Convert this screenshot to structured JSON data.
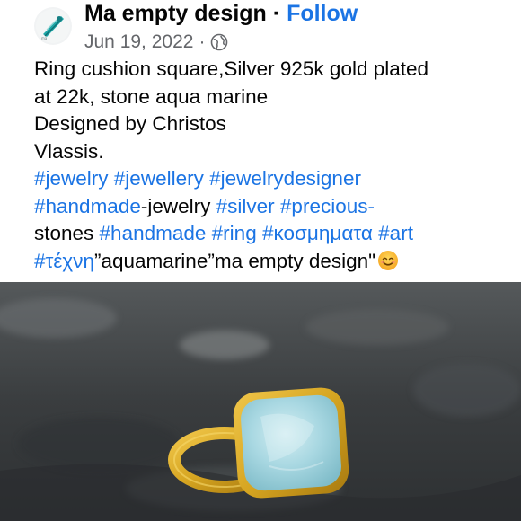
{
  "post": {
    "page_name": "Ma empty design",
    "separator": "·",
    "follow_label": "Follow",
    "date": "Jun 19, 2022",
    "meta_separator": "·",
    "privacy_icon": "globe-icon",
    "avatar_icon": "compass-logo-icon",
    "text": {
      "line1": "Ring cushion square,Silver 925k gold plated",
      "line2": "at 22k, stone aqua marine",
      "line3": "Designed by Christos",
      "line4": "Vlassis.",
      "tags_line5": [
        "#jewelry",
        "#jewellery",
        "#jewelrydesigner"
      ],
      "line6_tag1": "#handmade",
      "line6_text": "-jewelry ",
      "line6_tag2": "#silver",
      "line6_tag3": "#precious-",
      "line7_text": "stones ",
      "tags_line7": [
        "#handmade",
        "#ring",
        "#κοσμηματα",
        "#art"
      ],
      "line8_tag": "#τέχνη",
      "line8_text": "”aquamarine”ma empty design\"",
      "emoji": "smiling-face-emoji"
    },
    "photo": {
      "subject": "gold-plated ring with square aquamarine stone",
      "colors": {
        "stone": "#a9d8e2",
        "gold": "#d6a521",
        "background": "#3f4244"
      }
    }
  },
  "colors": {
    "link": "#1b74e4",
    "meta": "#65676b",
    "text": "#050505"
  }
}
